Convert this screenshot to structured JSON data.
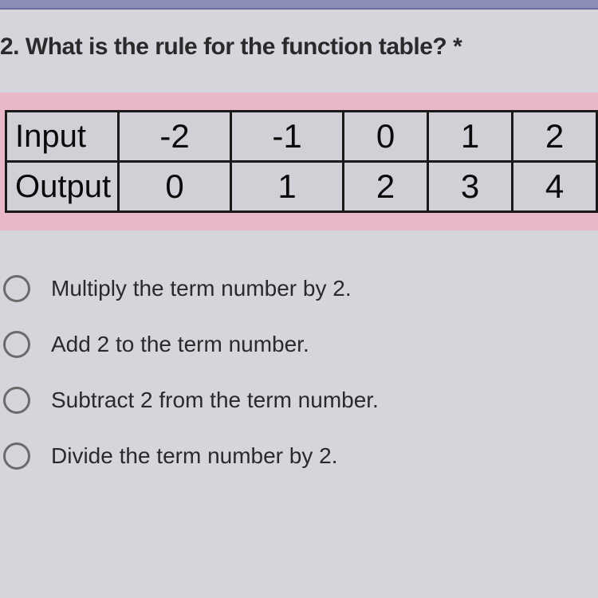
{
  "question": {
    "number": "2.",
    "text": "What is the rule for the function table?",
    "required_marker": "*"
  },
  "table": {
    "row_labels": [
      "Input",
      "Output"
    ],
    "input_values": [
      "-2",
      "-1",
      "0",
      "1",
      "2"
    ],
    "output_values": [
      "0",
      "1",
      "2",
      "3",
      "4"
    ]
  },
  "options": [
    "Multiply the term number by 2.",
    "Add 2 to the term number.",
    "Subtract 2 from the term number.",
    "Divide the term number by 2."
  ]
}
